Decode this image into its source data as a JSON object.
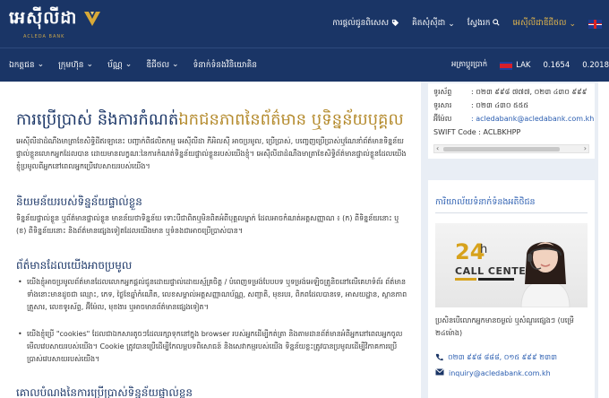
{
  "header": {
    "logo_text": "អេស៊ីលីដា",
    "logo_sub": "ACLEDA BANK",
    "nav": [
      {
        "label": "ការផ្តល់ជូនពិសេស",
        "icon": "tag-icon"
      },
      {
        "label": "គិតសុំស៊ីដា",
        "icon": "chevron-down-icon"
      },
      {
        "label": "ស្វែងរក",
        "icon": "search-icon"
      },
      {
        "label": "អេស៊ីលីដាឌីជីថល",
        "icon": "chevron-down-icon"
      }
    ],
    "language_flag": "uk-flag-icon"
  },
  "subnav": {
    "items": [
      "ឯកត្តជន",
      "ក្រុមហ៊ុន",
      "ប័ណ្ណ",
      "ឌីជីថល",
      "ទំនាក់ទំនងវិនិយោគិន"
    ],
    "rate_label": "អត្រាប្តូរប្រាក់",
    "currency": "LAK",
    "rate1": "0.1654",
    "rate2": "0.2018"
  },
  "main": {
    "title_part1": "ការប្រើប្រាស់ និងការកំណត់",
    "title_part2": "ឯកជនភាពនៃព័ត៌មាន ឬទិន្នន័យបុគ្គល",
    "intro": "អេស៊ីលីដាដំណឹងមាត្រាខែសិទ្ធិដីឥរឡានេះ បញ្ជាក់ពីផលិតកម្ម អេស៊ីលីដា ភីអិលស៊ី អាចប្រមូល, ប្រើប្រាស់, បញ្ចេញប្រើប្រាស់ឬណែនាំព័ត៌មានទិន្នន័យផ្ទាល់ខ្លួនលោកអ្នកដែលបាន ដោយមានលក្ខណៈនៃការកំណត់ទិន្នន័យផ្ទាល់ខ្លួនរបស់យើងខ្ញុំ។ អេស៊ីលីដាដំណឹងមាត្រាខែសិទ្ធិព័ត៌មានផ្ទាល់ខ្លួនដែលយើងខ្ញុំប្រមូលពីអ្នកនៅពេលអ្នកប្រើវេបសាយរបស់យើង។",
    "h_def": "និយមន័យរបស់ទិន្នន័យផ្ទាល់ខ្លួន",
    "def_text": "ទិន្នន័យផ្ទាល់ខ្លួន ឬព័ត៌មានផ្ទាល់ខ្លួន មានន័យថាទិន្នន័យ ទោះបីជាពិតឬមិនពិតអំពីបុគ្គលម្នាក់ ដែលអាចកំណត់អត្តសញ្ញាណ ៖ (ក) ពីទិន្នន័យនោះ ឬ (ខ) ពីទិន្នន័យនោះ និងព័ត៌មានផ្សេងទៀតដែលយើងមាន ឬទំនងជាអាចប្រើប្រាស់បាន។",
    "h_collect": "ព័ត៌មានដែលយើងអាចប្រមូល",
    "bullet1": "យើងខ្ញុំអាចប្រមូលព័ត៌មានដែលលោកអ្នកផ្តល់ជូនដោយផ្ទាល់ដោយស្ម័គ្រចិត្ត / បំពេញទម្រង់បែបបទ ឬទម្រង់អេឡិចត្រូនិចនៅលើគេហទំព័រ ព័ត៌មានទាំងនោះមានដូចជា ឈ្មោះ, ភេទ, ថ្ងៃខែឆ្នាំកំណើត, លេខសម្គាល់អត្តសញ្ញាណប័ណ្ណ, សញ្ជាតិ, មុខរបរ, ពិភពដែលបានទេ, អាសយដ្ឋាន, ស្ថានភាពគ្រួសារ, លេខទូរស័ព្ទ, អ៊ីម៉ែល, មុខងារ ឬអាចមានព័ត៌មានផ្សេងទៀត។",
    "bullet2": "យើងខ្ញុំប្រើ \"cookies\" ដែលជាឯកសារតូចៗដែលរក្សាទុកនៅក្នុង browser របស់អ្នកដើម្បីកត់ត្រា និងតាមដានព័ត៌មានអំពីអ្នកនៅពេលអ្នកចូលមើលវេបសាយរបស់យើង។ Cookie ត្រូវបានប្រើដើម្បីកែលម្អបទពិសោធន៍ និងសេវាកម្មរបស់យើង ទិន្នន័យខ្លះត្រូវបានប្រមូលដើម្បីវិភាគការប្រើប្រាស់វេបសាយរបស់យើង។",
    "h_purpose": "គោលបំណងនៃការប្រើប្រាស់ទិន្នន័យផ្ទាល់ខ្លួន"
  },
  "sidebar": {
    "info": {
      "phone_label": "ទូរស័ព្ទ",
      "phone_value": ": ០២៣ ៩៩៨ ៧៧៧, ០២៣ ៤៣០ ៩៩៩",
      "fax_label": "ទូរសារ",
      "fax_value": ": ០២៣ ៤៣០ ៥៥៥",
      "email_label": "អ៊ីម៉ែល",
      "email_value": ": acledabank@acledabank.com.kh",
      "swift": "SWIFT Code : ACLBKHPP"
    },
    "card": {
      "title": "ការិយាល័យទំនាក់ទំនងអតិថិជន",
      "photo_num": "24",
      "photo_h": "h",
      "photo_cc": "CALL CENTER",
      "desc": "ប្រសិនបើលោកអ្នកមានចម្ងល់ ឬសំណួរផ្សេងៗ (បម្រើ ២៤ម៉ោង)",
      "phone": "០២៣ ៩៩៨ ៨៨៨, ០១៥ ៩៩៩ ២៣៣",
      "email": "inquiry@acledabank.com.kh"
    }
  }
}
